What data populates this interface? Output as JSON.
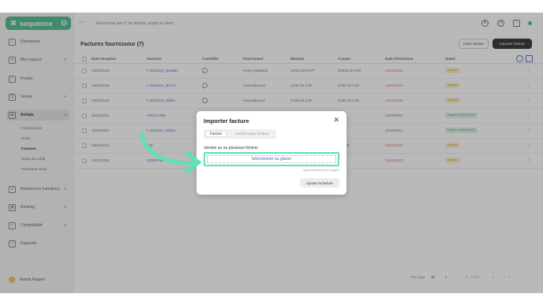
{
  "brand": {
    "name": "sequence"
  },
  "sidebar": {
    "items": [
      {
        "label": "Dashboard"
      },
      {
        "label": "Mon espace"
      },
      {
        "label": "Projets"
      },
      {
        "label": "Ventes"
      },
      {
        "label": "Achats"
      },
      {
        "label": "Ressources humaines"
      },
      {
        "label": "Banking"
      },
      {
        "label": "Comptabilité"
      },
      {
        "label": "Rapports"
      }
    ],
    "sub_items": [
      {
        "label": "Fournisseurs"
      },
      {
        "label": "Devis"
      },
      {
        "label": "Factures"
      },
      {
        "label": "Notes de crédit"
      },
      {
        "label": "Paiements émis"
      }
    ],
    "user": "Emma Rogers"
  },
  "search": {
    "placeholder": "Recherche par n° de facture, projet ou client"
  },
  "page": {
    "title": "Factures fournisseur (7)",
    "create_label": "Créer facture",
    "import_label": "Importer facture"
  },
  "table": {
    "headers": [
      "Date réception",
      "Factures",
      "Contrôlés",
      "Fournisseur",
      "Montant",
      "A payer",
      "Date d'échéance",
      "Statut"
    ],
    "rows": [
      {
        "date": "24/02/2025",
        "invoice": "# 2025224_5e0ddd",
        "supplier": "Henry Gaspard",
        "amount": "10'810.00 CHF",
        "to_pay": "10'810.00 CHF",
        "due": "24/02/2025",
        "status": "A payer",
        "status_type": "warn",
        "due_red": true
      },
      {
        "date": "24/02/2025",
        "invoice": "# 2025224_3b77a",
        "supplier": "Anna Bernard",
        "amount": "3'231.00 CHF",
        "to_pay": "3'231.00 CHF",
        "due": "24/02/2025",
        "status": "A payer",
        "status_type": "warn",
        "due_red": true
      },
      {
        "date": "24/02/2025",
        "invoice": "# 2025224_c85b1",
        "supplier": "Anna Bernard",
        "amount": "2'162.00 CHF",
        "to_pay": "2'162.00 CHF",
        "due": "24/02/2025",
        "status": "A payer",
        "status_type": "warn",
        "due_red": true
      },
      {
        "date": "01/11/2024",
        "invoice": "#29113-908",
        "supplier": "",
        "amount": "",
        "to_pay": "CHF",
        "due": "22/08/2021",
        "status": "Payée le 24/02/2025",
        "status_type": "paid",
        "due_red": false
      },
      {
        "date": "11/04/2024",
        "invoice": "# 2024411_a5b6a",
        "supplier": "",
        "amount": "",
        "to_pay": "CHF",
        "due": "11/04/2024",
        "status": "Payée le 24/02/2025",
        "status_type": "paid",
        "due_red": false
      },
      {
        "date": "08/03/2024",
        "invoice": "#29",
        "supplier": "",
        "amount": "",
        "to_pay": "00 CHF",
        "due": "25/03/2024",
        "status": "A payer",
        "status_type": "warn",
        "due_red": true
      },
      {
        "date": "12/12/2023",
        "invoice": "#22803-88",
        "supplier": "",
        "amount": "",
        "to_pay": "CHF",
        "due": "12/12/2023",
        "status": "A payer",
        "status_type": "warn",
        "due_red": true
      }
    ]
  },
  "pager": {
    "per_page_label": "Par page",
    "per_page_value": "10",
    "range": "1 - 7 of 7"
  },
  "modal": {
    "title": "Importer facture",
    "tabs": [
      "Facture",
      "Facture sans écriture"
    ],
    "attach_label": "Joindre un ou plusieurs fichiers",
    "drop_label": "Sélectionner ou glisser",
    "hint": "application/pdf ou image/*",
    "add_label": "Ajouter la facture"
  },
  "colors": {
    "accent": "#3fb285",
    "highlight": "#5fe0b5",
    "link": "#3b67c9",
    "danger": "#e05a4a"
  }
}
